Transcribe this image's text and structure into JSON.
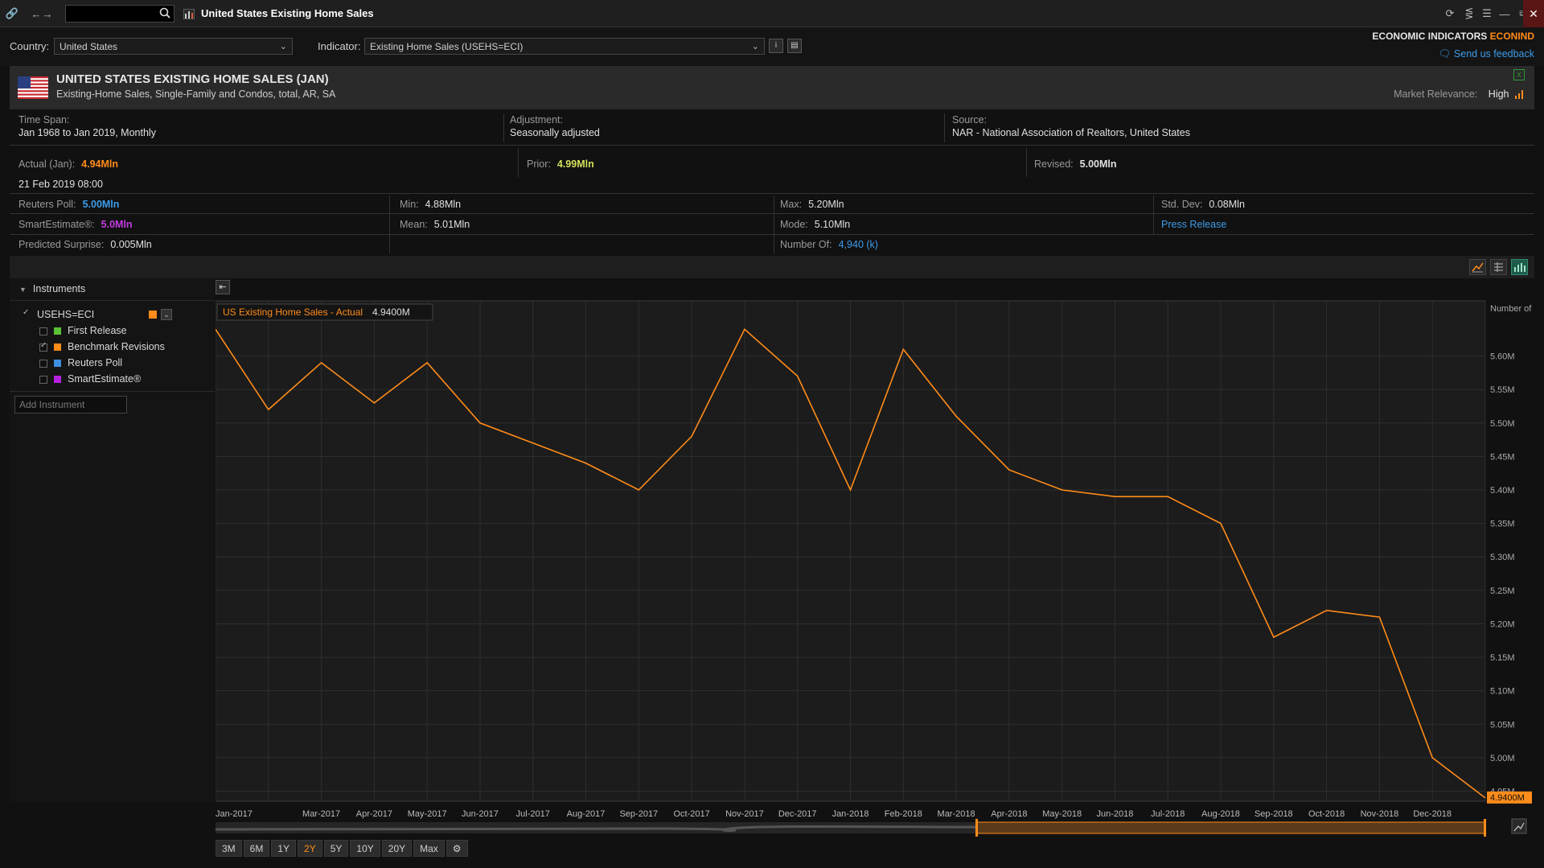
{
  "window": {
    "title": "United States Existing Home Sales"
  },
  "controls": {
    "country_label": "Country:",
    "country_value": "United States",
    "indicator_label": "Indicator:",
    "indicator_value": "Existing Home Sales (USEHS=ECI)",
    "brand_prefix": "ECONOMIC INDICATORS",
    "brand_code": "ECONIND",
    "feedback": "Send us feedback"
  },
  "header": {
    "title": "UNITED STATES EXISTING HOME SALES (JAN)",
    "subtitle": "Existing-Home Sales, Single-Family and Condos, total, AR, SA",
    "relevance_label": "Market Relevance:",
    "relevance_value": "High"
  },
  "meta": {
    "timespan_label": "Time Span:",
    "timespan_value": "Jan 1968 to Jan 2019, Monthly",
    "adjustment_label": "Adjustment:",
    "adjustment_value": "Seasonally adjusted",
    "source_label": "Source:",
    "source_value": "NAR - National Association of Realtors, United States"
  },
  "stats": {
    "actual_label": "Actual (Jan):",
    "actual_value": "4.94Mln",
    "prior_label": "Prior:",
    "prior_value": "4.99Mln",
    "revised_label": "Revised:",
    "revised_value": "5.00Mln",
    "release_date": "21 Feb 2019 08:00",
    "poll_label": "Reuters Poll:",
    "poll_value": "5.00Mln",
    "min_label": "Min:",
    "min_value": "4.88Mln",
    "max_label": "Max:",
    "max_value": "5.20Mln",
    "stddev_label": "Std. Dev:",
    "stddev_value": "0.08Mln",
    "smart_label": "SmartEstimate®:",
    "smart_value": "5.0Mln",
    "mean_label": "Mean:",
    "mean_value": "5.01Mln",
    "mode_label": "Mode:",
    "mode_value": "5.10Mln",
    "press_release": "Press Release",
    "surprise_label": "Predicted Surprise:",
    "surprise_value": "0.005Mln",
    "numberof_label": "Number Of:",
    "numberof_value": "4,940 (k)"
  },
  "instruments": {
    "header": "Instruments",
    "ric": "USEHS=ECI",
    "items": [
      {
        "label": "First Release",
        "color": "#5bc236",
        "checked": false
      },
      {
        "label": "Benchmark Revisions",
        "color": "#ff8c1a",
        "checked": true
      },
      {
        "label": "Reuters Poll",
        "color": "#3d8fe0",
        "checked": false
      },
      {
        "label": "SmartEstimate®",
        "color": "#b621e0",
        "checked": false
      }
    ],
    "add_placeholder": "Add Instrument"
  },
  "range_buttons": [
    "3M",
    "6M",
    "1Y",
    "2Y",
    "5Y",
    "10Y",
    "20Y",
    "Max"
  ],
  "active_range": "2Y",
  "colors": {
    "series": "#ff8c1a",
    "accent_blue": "#3d9be8",
    "purple": "#c23ce0",
    "prior_yellow": "#d4e05a"
  },
  "chart_data": {
    "type": "line",
    "legend_series": "US Existing Home Sales - Actual",
    "legend_value": "4.9400M",
    "y_axis_title": "Number of",
    "last_value_tag": "4.9400M",
    "x": [
      "Jan-2017",
      "Feb-2017",
      "Mar-2017",
      "Apr-2017",
      "May-2017",
      "Jun-2017",
      "Jul-2017",
      "Aug-2017",
      "Sep-2017",
      "Oct-2017",
      "Nov-2017",
      "Dec-2017",
      "Jan-2018",
      "Feb-2018",
      "Mar-2018",
      "Apr-2018",
      "May-2018",
      "Jun-2018",
      "Jul-2018",
      "Aug-2018",
      "Sep-2018",
      "Oct-2018",
      "Nov-2018",
      "Dec-2018",
      "Jan-2019"
    ],
    "x_tick_labels": [
      "Jan-2017",
      "",
      "Mar-2017",
      "Apr-2017",
      "May-2017",
      "Jun-2017",
      "Jul-2017",
      "Aug-2017",
      "Sep-2017",
      "Oct-2017",
      "Nov-2017",
      "Dec-2017",
      "Jan-2018",
      "Feb-2018",
      "Mar-2018",
      "Apr-2018",
      "May-2018",
      "Jun-2018",
      "Jul-2018",
      "Aug-2018",
      "Sep-2018",
      "Oct-2018",
      "Nov-2018",
      "Dec-2018",
      ""
    ],
    "series": [
      {
        "name": "US Existing Home Sales - Actual",
        "values": [
          5.64,
          5.52,
          5.59,
          5.53,
          5.59,
          5.5,
          5.47,
          5.44,
          5.4,
          5.48,
          5.64,
          5.57,
          5.4,
          5.61,
          5.51,
          5.43,
          5.4,
          5.39,
          5.39,
          5.35,
          5.18,
          5.22,
          5.21,
          5.0,
          4.94
        ]
      }
    ],
    "y_ticks": [
      "4.95M",
      "5.00M",
      "5.05M",
      "5.10M",
      "5.15M",
      "5.20M",
      "5.25M",
      "5.30M",
      "5.35M",
      "5.40M",
      "5.45M",
      "5.50M",
      "5.55M",
      "5.60M"
    ],
    "ylim": [
      4.935,
      5.68
    ],
    "grid": true
  }
}
